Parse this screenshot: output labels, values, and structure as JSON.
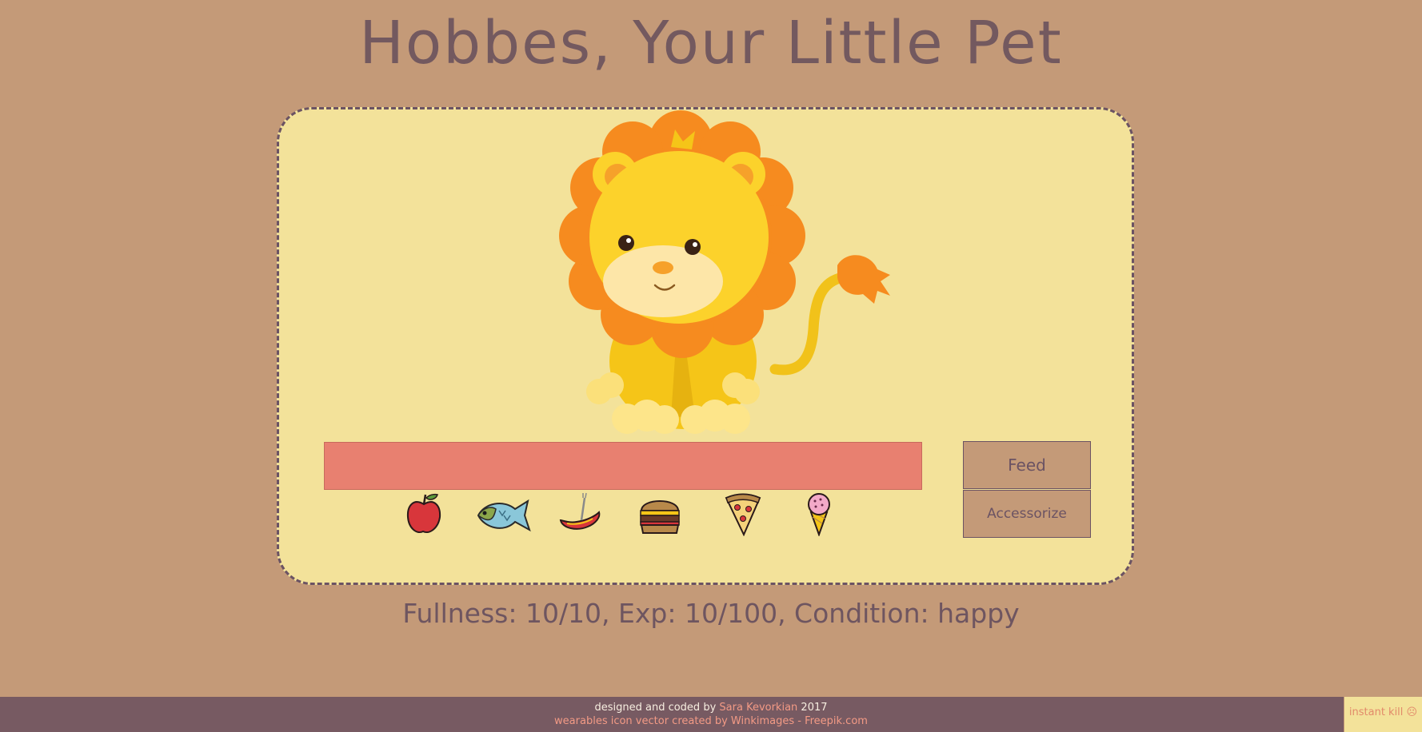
{
  "header": {
    "title": "Hobbes, Your Little Pet"
  },
  "pet": {
    "icon": "lion-icon"
  },
  "hunger_bar": {
    "level": 1.0,
    "color": "#e88070"
  },
  "buttons": {
    "feed": "Feed",
    "accessorize": "Accessorize"
  },
  "foods": [
    {
      "name": "apple-icon"
    },
    {
      "name": "fish-icon"
    },
    {
      "name": "sausage-icon"
    },
    {
      "name": "burger-icon"
    },
    {
      "name": "pizza-icon"
    },
    {
      "name": "ice-cream-icon"
    }
  ],
  "stats": {
    "text": "Fullness: 10/10, Exp: 10/100, Condition: happy"
  },
  "footer": {
    "line1_prefix": "designed and coded by",
    "author": "Sara Kevorkian",
    "year": "2017",
    "credit": "wearables icon vector created by Winkimages - Freepik.com"
  },
  "instant_kill": {
    "label": "instant kill ☹"
  },
  "colors": {
    "background": "#c49a78",
    "pet_box": "#f3e29a",
    "text": "#73595f",
    "footer": "#775a62",
    "accent": "#f39a85"
  }
}
